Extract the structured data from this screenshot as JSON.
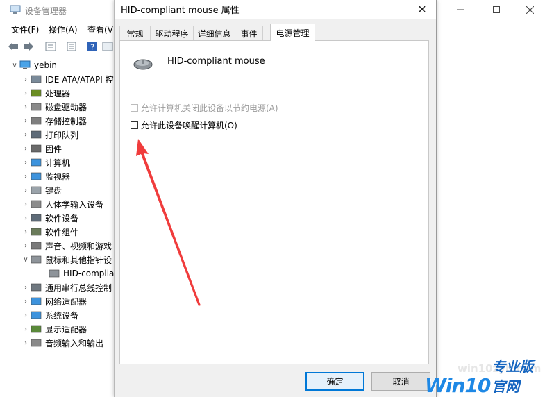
{
  "device_manager": {
    "title": "设备管理器",
    "menu": [
      "文件(F)",
      "操作(A)",
      "查看(V"
    ],
    "tree": {
      "root": "yebin",
      "items": [
        {
          "label": "IDE ATA/ATAPI 控",
          "icon": "ide-controller-icon"
        },
        {
          "label": "处理器",
          "icon": "processor-icon"
        },
        {
          "label": "磁盘驱动器",
          "icon": "disk-drive-icon"
        },
        {
          "label": "存储控制器",
          "icon": "storage-controller-icon"
        },
        {
          "label": "打印队列",
          "icon": "printer-icon"
        },
        {
          "label": "固件",
          "icon": "firmware-icon"
        },
        {
          "label": "计算机",
          "icon": "computer-icon"
        },
        {
          "label": "监视器",
          "icon": "monitor-icon"
        },
        {
          "label": "键盘",
          "icon": "keyboard-icon"
        },
        {
          "label": "人体学输入设备",
          "icon": "hid-icon"
        },
        {
          "label": "软件设备",
          "icon": "software-device-icon"
        },
        {
          "label": "软件组件",
          "icon": "software-component-icon"
        },
        {
          "label": "声音、视频和游戏",
          "icon": "sound-icon"
        },
        {
          "label": "鼠标和其他指针设",
          "icon": "mouse-icon",
          "expanded": true
        },
        {
          "label": "HID-complian",
          "icon": "mouse-icon",
          "child": true
        },
        {
          "label": "通用串行总线控制",
          "icon": "usb-icon"
        },
        {
          "label": "网络适配器",
          "icon": "network-adapter-icon"
        },
        {
          "label": "系统设备",
          "icon": "system-device-icon"
        },
        {
          "label": "显示适配器",
          "icon": "display-adapter-icon"
        },
        {
          "label": "音频输入和输出",
          "icon": "audio-icon"
        }
      ]
    }
  },
  "dialog": {
    "title": "HID-compliant mouse 属性",
    "close_glyph": "✕",
    "tabs": [
      "常规",
      "驱动程序",
      "详细信息",
      "事件",
      "电源管理"
    ],
    "active_tab": "电源管理",
    "device_name": "HID-compliant mouse",
    "options": [
      {
        "label": "允许计算机关闭此设备以节约电源(A)",
        "checked": false,
        "enabled": false
      },
      {
        "label": "允许此设备唤醒计算机(O)",
        "checked": false,
        "enabled": true
      }
    ],
    "buttons": {
      "ok": "确定",
      "cancel": "取消"
    }
  },
  "annotation": {
    "arrow_color": "#f03c3c"
  },
  "watermark": {
    "url": "win10zyb.com",
    "logo_main": "Win10",
    "logo_sub": "专业版官网"
  }
}
